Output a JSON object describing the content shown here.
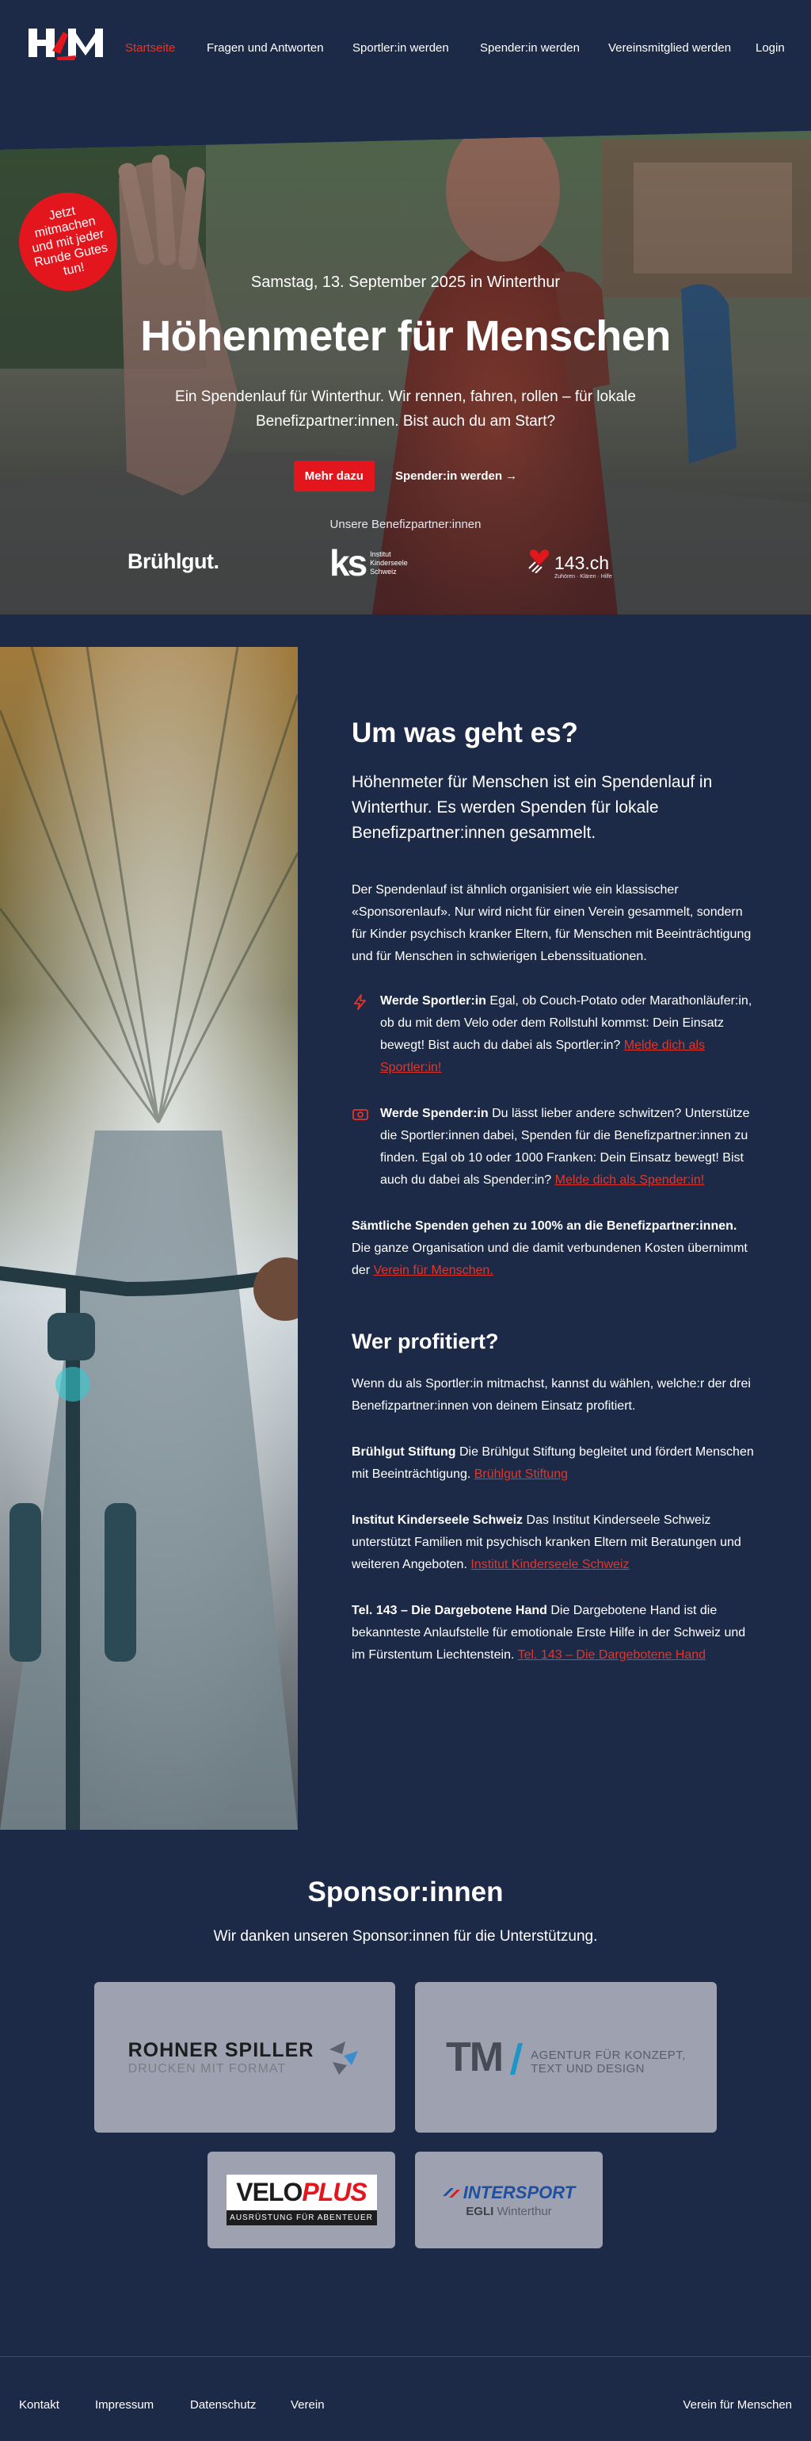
{
  "nav": {
    "logo_text": "HfM",
    "items": [
      {
        "label": "Startseite"
      },
      {
        "label": "Fragen und Antworten"
      },
      {
        "label": "Sportler:in werden"
      },
      {
        "label": "Spender:in werden"
      },
      {
        "label": "Vereinsmitglied werden"
      },
      {
        "label": "Login"
      }
    ]
  },
  "hero": {
    "badge": "Jetzt mitmachen und mit jeder Runde Gutes tun!",
    "date": "Samstag, 13. September 2025 in Winterthur",
    "title": "Höhenmeter für Menschen",
    "subtitle": "Ein Spendenlauf für Winterthur. Wir rennen, fahren, rollen – für lokale Benefizpartner:innen. Bist auch du am Start?",
    "primary_button": "Mehr dazu",
    "secondary_button": "Spender:in werden →",
    "partners_label": "Unsere Benefizpartner:innen",
    "partners": {
      "bruehlgut": "Brühlgut.",
      "ks_mark": "ks",
      "ks_text": "Institut Kinderseele Schweiz",
      "tel143": "143.ch",
      "tel143_sub": "Zuhören · Klären · Hilfe"
    }
  },
  "about": {
    "title": "Um was geht es?",
    "lead": "Höhenmeter für Menschen ist ein Spendenlauf in Winterthur. Es werden Spenden für lokale Benefizpartner:innen gesammelt.",
    "intro": "Der Spendenlauf ist ähnlich organisiert wie ein klassischer «Sponsorenlauf». Nur wird nicht für einen Verein gesammelt, sondern für Kinder psychisch kranker Eltern, für Menschen mit Beeinträchtigung und für Menschen in schwierigen Lebenssituationen.",
    "feature_athlete": {
      "title": "Werde Sportler:in",
      "text": " Egal, ob Couch-Potato oder Marathonläufer:in, ob du mit dem Velo oder dem Rollstuhl kommst: Dein Einsatz bewegt! Bist auch du dabei als Sportler:in? ",
      "link": "Melde dich als Sportler:in!"
    },
    "feature_donor": {
      "title": "Werde Spender:in",
      "text": " Du lässt lieber andere schwitzen? Unterstütze die Sportler:innen dabei, Spenden für die Benefizpartner:innen zu finden. Egal ob 10 oder 1000 Franken: Dein Einsatz bewegt! Bist auch du dabei als Spender:in? ",
      "link": "Melde dich als Spender:in!"
    },
    "all_donations_bold": "Sämtliche Spenden gehen zu 100% an die Benefizpartner:innen.",
    "all_donations_text": " Die ganze Organisation und die damit verbundenen Kosten übernimmt der ",
    "all_donations_link": "Verein für Menschen.",
    "who_title": "Wer profitiert?",
    "who_intro": "Wenn du als Sportler:in mitmachst, kannst du wählen, welche:r der drei Benefizpartner:innen von deinem Einsatz profitiert.",
    "beneficiaries": [
      {
        "name": "Brühlgut Stiftung",
        "text": " Die Brühlgut Stiftung begleitet und fördert Menschen mit Beeinträchtigung. ",
        "link": "Brühlgut Stiftung"
      },
      {
        "name": "Institut Kinderseele Schweiz",
        "text": " Das Institut Kinderseele Schweiz unterstützt Familien mit psychisch kranken Eltern mit Beratungen und weiteren Angeboten. ",
        "link": "Institut Kinderseele Schweiz"
      },
      {
        "name": "Tel. 143 – Die Dargebotene Hand",
        "text": " Die Dargebotene Hand ist die bekannteste Anlaufstelle für emotionale Erste Hilfe in der Schweiz und im Fürstentum Liechtenstein. ",
        "link": "Tel. 143 – Die Dargebotene Hand"
      }
    ]
  },
  "sponsors": {
    "title": "Sponsor:innen",
    "subtitle": "Wir danken unseren Sponsor:innen für die Unterstützung.",
    "rohner": {
      "name": "ROHNER SPILLER",
      "tagline": "DRUCKEN MIT FORMAT"
    },
    "tm": {
      "mark": "TM",
      "line1": "AGENTUR FÜR KONZEPT,",
      "line2": "TEXT UND DESIGN"
    },
    "veloplus": {
      "velo": "VELO",
      "plus": "PLUS",
      "tagline": "AUSRÜSTUNG FÜR ABENTEUER"
    },
    "intersport": {
      "name": "INTERSPORT",
      "sub1": "EGLI",
      "sub2": " Winterthur"
    }
  },
  "footer": {
    "links": [
      {
        "label": "Kontakt"
      },
      {
        "label": "Impressum"
      },
      {
        "label": "Datenschutz"
      },
      {
        "label": "Verein"
      }
    ],
    "right": "Verein für Menschen"
  },
  "colors": {
    "background": "#1c2a47",
    "accent_red": "#e3161e",
    "link_red": "#e3362b",
    "sponsor_card": "#9ea2b0"
  }
}
